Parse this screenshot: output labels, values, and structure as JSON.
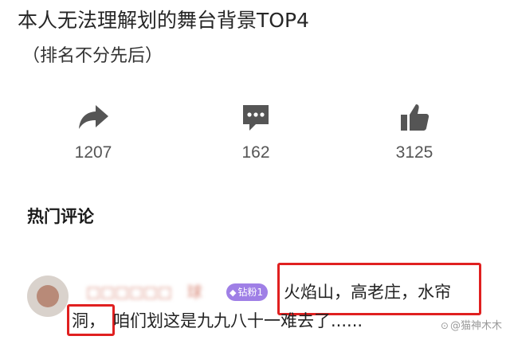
{
  "post": {
    "title": "本人无法理解划的舞台背景TOP4",
    "subtitle": "（排名不分先后）"
  },
  "actions": {
    "share": {
      "icon": "share-icon",
      "count": "1207"
    },
    "comment": {
      "icon": "comment-icon",
      "count": "162"
    },
    "like": {
      "icon": "thumbs-up-icon",
      "count": "3125"
    }
  },
  "hot_comments": {
    "title": "热门评论"
  },
  "comment": {
    "username_visible": "球",
    "badge": "钻粉1",
    "text_highlight_1": "火焰山，高老庄，水帘",
    "text_highlight_2": "洞，",
    "text_rest": "咱们划这是九九八十一难去了......"
  },
  "watermark": "@猫神木木",
  "colors": {
    "highlight_box": "#e02020",
    "badge": "#9f7fe6",
    "icon": "#555555"
  }
}
